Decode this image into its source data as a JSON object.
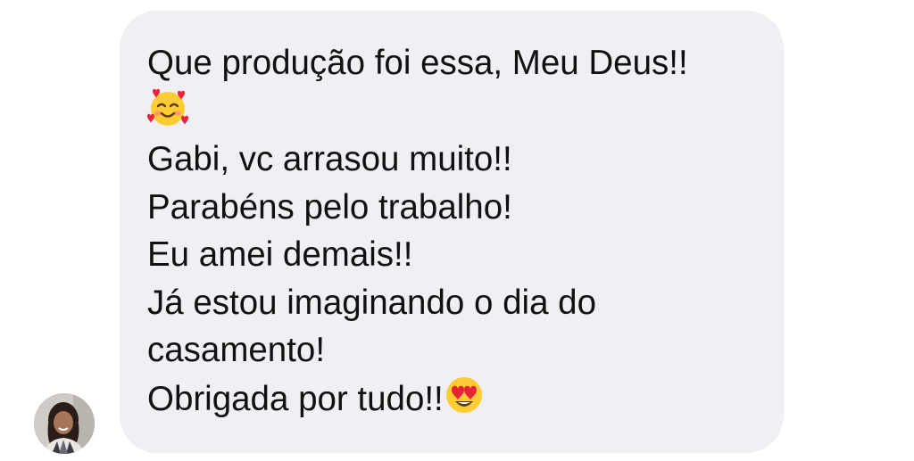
{
  "message": {
    "lines": [
      "Que produção foi essa,  Meu Deus!!",
      "",
      "Gabi, vc arrasou muito!!",
      "Parabéns pelo trabalho!",
      "Eu amei demais!!",
      "Já estou imaginando o dia do",
      "casamento!",
      "Obrigada por tudo!!"
    ],
    "emojis": [
      "smiling-face-with-hearts-emoji",
      "heart-eyes-emoji"
    ]
  },
  "sender": {
    "avatar_icon": "profile-photo"
  },
  "colors": {
    "bubble": "#efeff4",
    "text": "#111111",
    "emoji_face": "#ffcc33",
    "heart": "#e8223b"
  }
}
